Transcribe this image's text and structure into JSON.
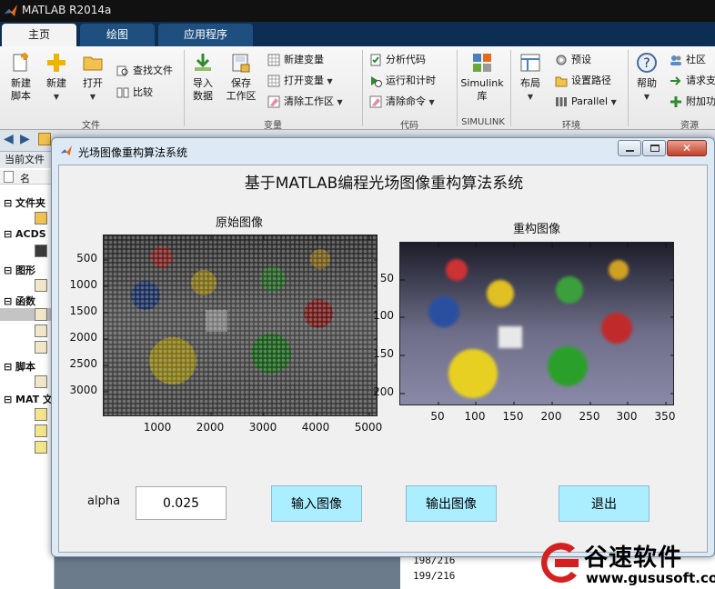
{
  "app": {
    "title": "MATLAB R2014a",
    "tabs": [
      "主页",
      "绘图",
      "应用程序"
    ]
  },
  "ribbon": {
    "file": {
      "new_script": "新建\n脚本",
      "new": "新建",
      "open": "打开",
      "find_files": "查找文件",
      "compare": "比较",
      "group": "文件"
    },
    "variable": {
      "import": "导入\n数据",
      "save_ws": "保存\n工作区",
      "new_var": "新建变量",
      "open_var": "打开变量",
      "clear_ws": "清除工作区",
      "group": "变量"
    },
    "code": {
      "analyze": "分析代码",
      "run_time": "运行和计时",
      "clear_cmd": "清除命令",
      "group": "代码"
    },
    "simulink": {
      "lib": "Simulink\n库",
      "group": "SIMULINK"
    },
    "env": {
      "layout": "布局",
      "prefs": "预设",
      "set_path": "设置路径",
      "parallel": "Parallel",
      "group": "环境"
    },
    "resources": {
      "help": "帮助",
      "community": "社区",
      "request": "请求支",
      "addons": "附加功",
      "group": "资源"
    }
  },
  "left_panel": {
    "header": "当前文件",
    "col": "名",
    "items": [
      "文件夹",
      "ACDS",
      "图形",
      "函数",
      "脚本",
      "MAT 文"
    ]
  },
  "command": {
    "lines": [
      "198/216",
      "199/216"
    ]
  },
  "figure": {
    "window_title": "光场图像重构算法系统",
    "main_title": "基于MATLAB编程光场图像重构算法系统",
    "left_axes": {
      "title": "原始图像",
      "xticks": [
        "1000",
        "2000",
        "3000",
        "4000",
        "5000"
      ],
      "yticks": [
        "500",
        "1000",
        "1500",
        "2000",
        "2500",
        "3000"
      ]
    },
    "right_axes": {
      "title": "重构图像",
      "xticks": [
        "50",
        "100",
        "150",
        "200",
        "250",
        "300",
        "350"
      ],
      "yticks": [
        "50",
        "100",
        "150",
        "200"
      ]
    },
    "alpha_label": "alpha",
    "alpha_value": "0.025",
    "buttons": {
      "input": "输入图像",
      "output": "输出图像",
      "exit": "退出"
    }
  },
  "watermark": {
    "name": "谷速软件",
    "url": "www.gususoft.com"
  },
  "colors": {
    "tabbar": "#0c2e52",
    "button": "#aaeeff",
    "figure_bg": "#f0f0f0",
    "watermark_red": "#d42020"
  }
}
